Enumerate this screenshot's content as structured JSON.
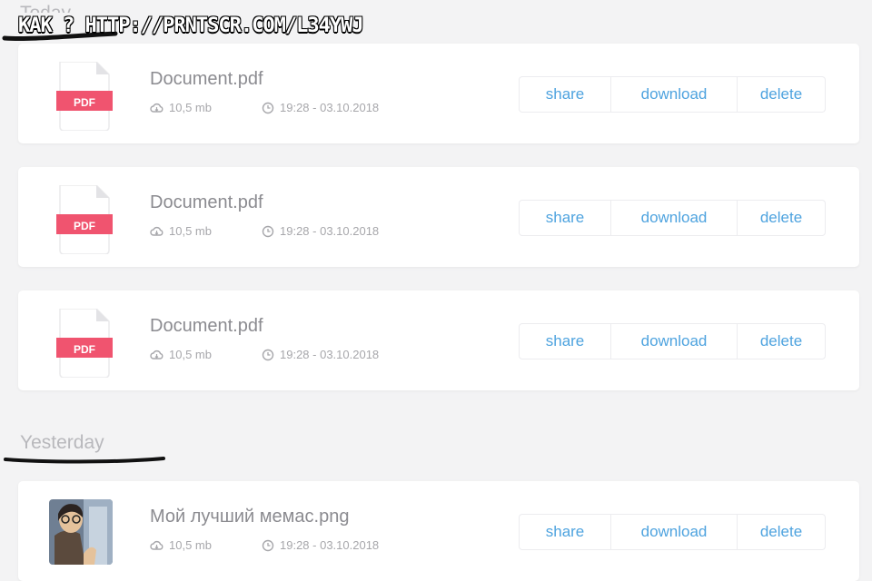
{
  "caption": "КАК ? HTTP://PRNTSCR.COM/L34YWJ",
  "sections": [
    {
      "label": "Today",
      "files": [
        {
          "name": "Document.pdf",
          "type": "PDF",
          "size": "10,5 mb",
          "time": "19:28 - 03.10.2018"
        },
        {
          "name": "Document.pdf",
          "type": "PDF",
          "size": "10,5 mb",
          "time": "19:28 - 03.10.2018"
        },
        {
          "name": "Document.pdf",
          "type": "PDF",
          "size": "10,5 mb",
          "time": "19:28 - 03.10.2018"
        }
      ]
    },
    {
      "label": "Yesterday",
      "files": [
        {
          "name": "Мой лучший мемас.png",
          "size": "10,5 mb",
          "time": "19:28 - 03.10.2018"
        }
      ]
    }
  ],
  "actions": {
    "share": "share",
    "download": "download",
    "delete": "delete"
  },
  "colors": {
    "accent": "#4ea3df",
    "pdf_badge": "#f0546f"
  },
  "icons": {
    "size": "cloud-icon",
    "time": "clock-icon",
    "file": "pdf-file-icon"
  }
}
